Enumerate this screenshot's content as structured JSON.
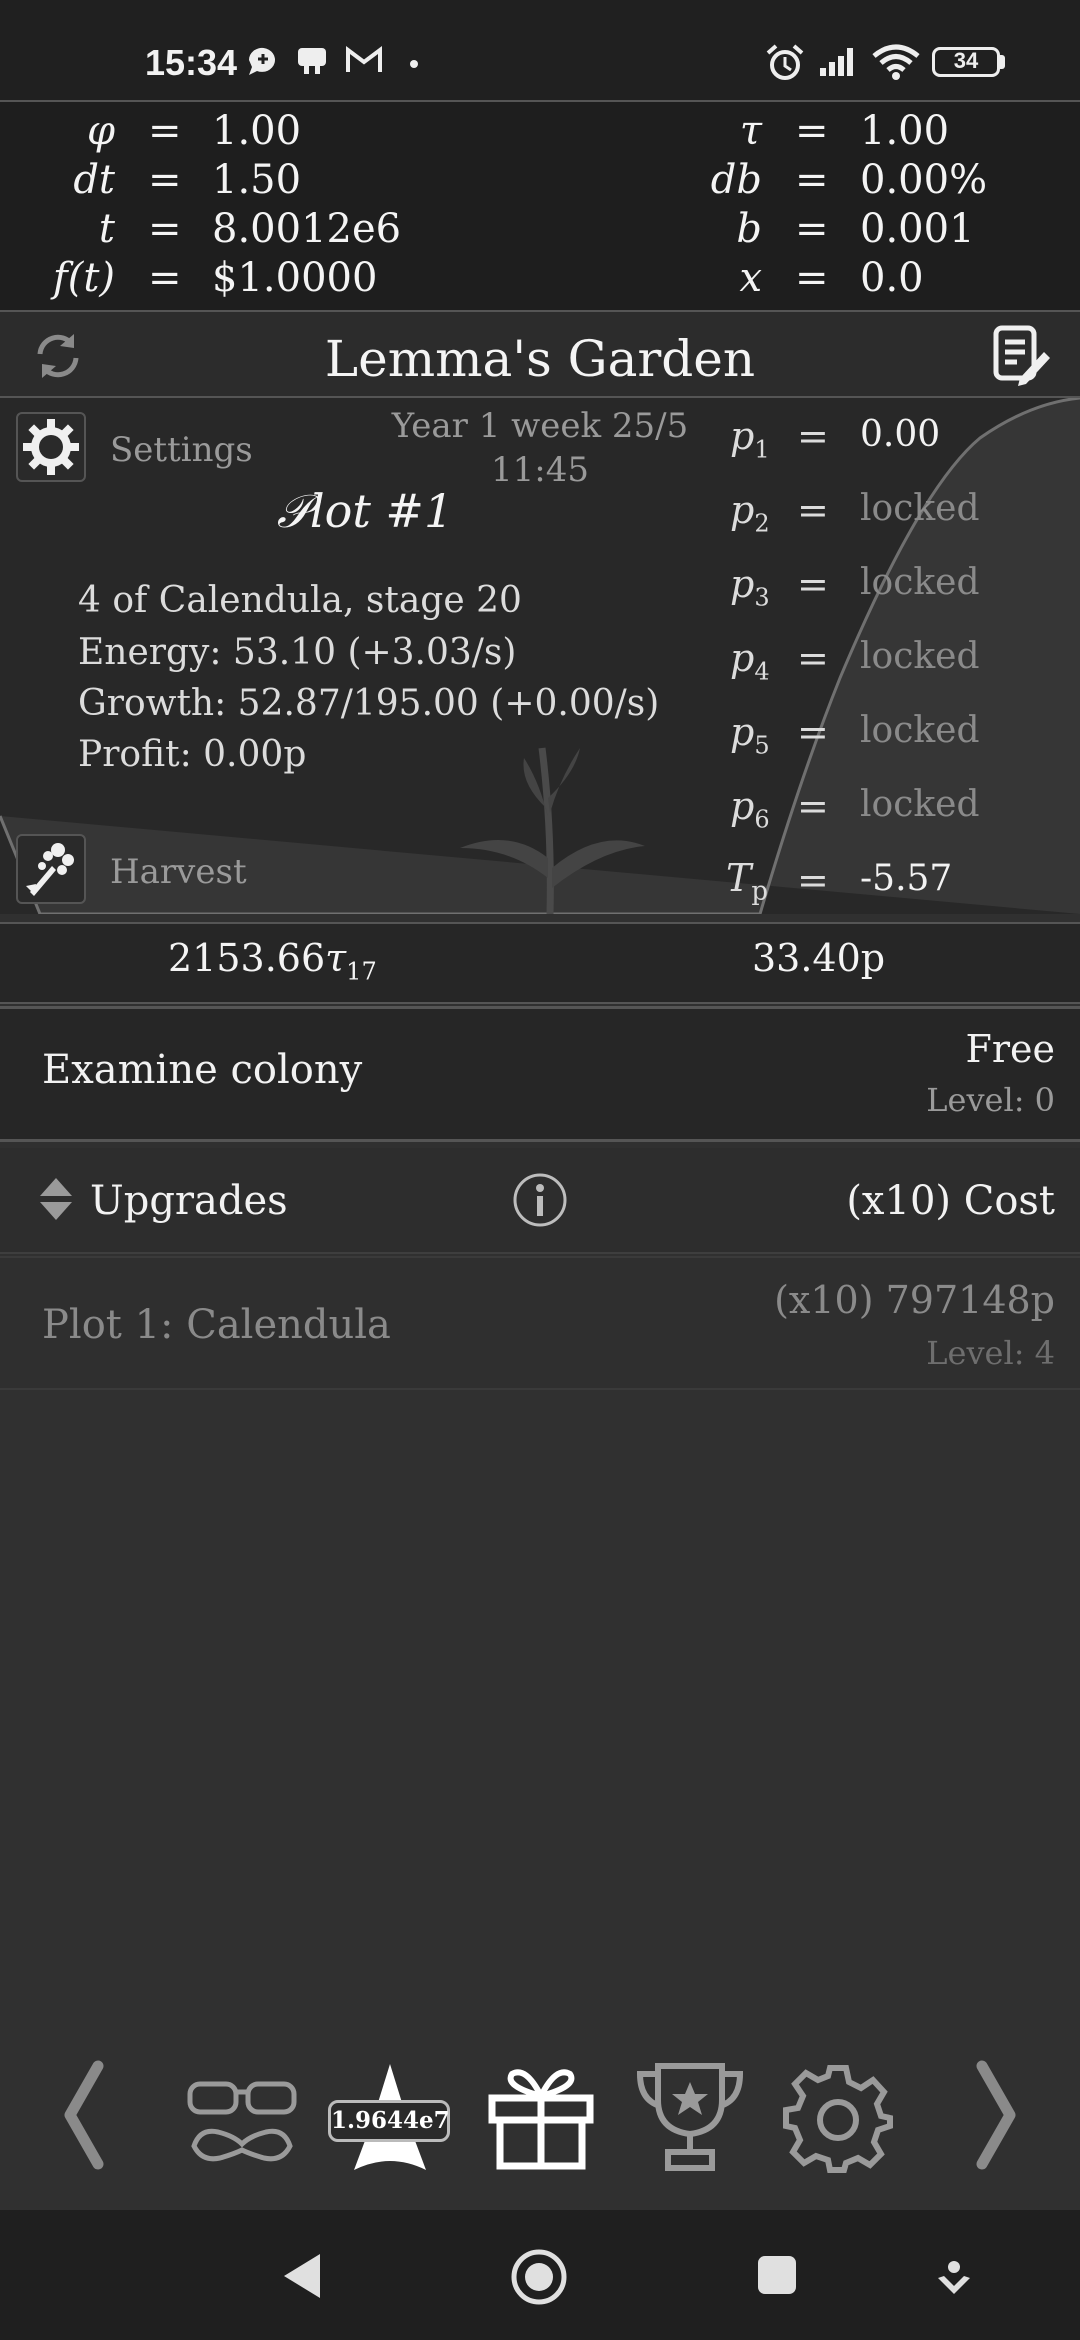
{
  "status_bar": {
    "time": "15:34",
    "battery": "34",
    "icons": [
      "chat-bubble-icon",
      "notification-icon",
      "gmail-icon",
      "dot-icon",
      "alarm-icon",
      "signal-icon",
      "wifi-icon",
      "battery-icon"
    ]
  },
  "variables": {
    "left": [
      {
        "name": "φ",
        "eq": "=",
        "value": "1.00"
      },
      {
        "name": "dt",
        "eq": "=",
        "value": "1.50"
      },
      {
        "name": "t",
        "eq": "=",
        "value": "8.0012e6"
      },
      {
        "name": "f(t)",
        "eq": "=",
        "value": "$1.0000"
      }
    ],
    "right": [
      {
        "name": "τ",
        "eq": "=",
        "value": "1.00"
      },
      {
        "name": "db",
        "eq": "=",
        "value": "0.00%"
      },
      {
        "name": "b",
        "eq": "=",
        "value": "0.001"
      },
      {
        "name": "x",
        "eq": "=",
        "value": "0.0"
      }
    ]
  },
  "title_bar": {
    "title": "Lemma's Garden",
    "left_icon": "refresh-icon",
    "right_icon": "notes-edit-icon"
  },
  "garden": {
    "date": "Year 1 week 25/5",
    "clock": "11:45",
    "settings_label": "Settings",
    "plot_title": "𝒫lot #1",
    "lines": [
      "4 of Calendula, stage 20",
      "Energy: 53.10 (+3.03/s)",
      "Growth: 52.87/195.00 (+0.00/s)",
      "Profit: 0.00p"
    ],
    "harvest_label": "Harvest",
    "params": [
      {
        "name": "p",
        "sub": "1",
        "eq": "=",
        "value": "0.00",
        "locked": false
      },
      {
        "name": "p",
        "sub": "2",
        "eq": "=",
        "value": "locked",
        "locked": true
      },
      {
        "name": "p",
        "sub": "3",
        "eq": "=",
        "value": "locked",
        "locked": true
      },
      {
        "name": "p",
        "sub": "4",
        "eq": "=",
        "value": "locked",
        "locked": true
      },
      {
        "name": "p",
        "sub": "5",
        "eq": "=",
        "value": "locked",
        "locked": true
      },
      {
        "name": "p",
        "sub": "6",
        "eq": "=",
        "value": "locked",
        "locked": true
      },
      {
        "name": "T",
        "sub": "p",
        "eq": "=",
        "value": "-5.57",
        "locked": false
      }
    ]
  },
  "currency": {
    "tau_value": "2153.66",
    "tau_symbol": "τ",
    "tau_sub": "17",
    "p_value": "33.40p"
  },
  "examine": {
    "label": "Examine colony",
    "cost": "Free",
    "level": "Level: 0"
  },
  "upgrades": {
    "label": "Upgrades",
    "info_icon": "info-icon",
    "cost_header": "(x10) Cost"
  },
  "upgrade_items": [
    {
      "name": "Plot 1: Calendula",
      "cost": "(x10) 797148p",
      "level": "Level: 4"
    }
  ],
  "bottom_bar": {
    "star_value": "1.9644e7",
    "icons": [
      "chevron-left-icon",
      "glasses-mustache-icon",
      "star-icon",
      "gift-icon",
      "trophy-icon",
      "gear-icon",
      "chevron-right-icon"
    ]
  },
  "nav_bar": {
    "icons": [
      "nav-back-icon",
      "nav-home-icon",
      "nav-recents-icon",
      "nav-assist-icon"
    ]
  },
  "colors": {
    "background": "#303030",
    "panel_dark": "#1e1e1e",
    "text": "#f2f2f2",
    "muted": "#9a9a9a"
  }
}
